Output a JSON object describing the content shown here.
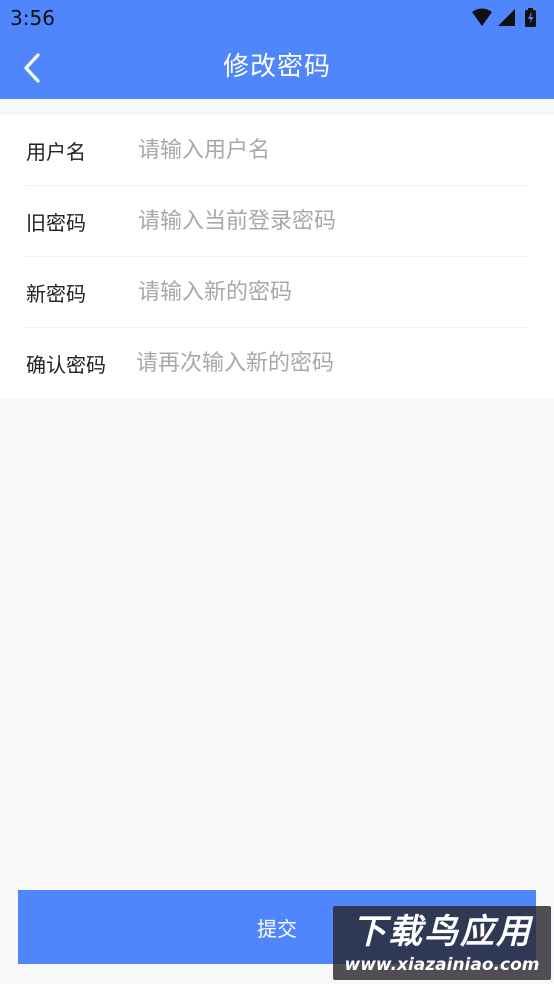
{
  "status_bar": {
    "time": "3:56",
    "icons": [
      "wifi-icon",
      "signal-icon",
      "battery-icon"
    ]
  },
  "app_bar": {
    "title": "修改密码",
    "back_icon": "chevron-left-icon"
  },
  "form": {
    "fields": [
      {
        "label": "用户名",
        "placeholder": "请输入用户名",
        "value": ""
      },
      {
        "label": "旧密码",
        "placeholder": "请输入当前登录密码",
        "value": ""
      },
      {
        "label": "新密码",
        "placeholder": "请输入新的密码",
        "value": ""
      },
      {
        "label": "确认密码",
        "placeholder": "请再次输入新的密码",
        "value": ""
      }
    ]
  },
  "submit": {
    "label": "提交"
  },
  "watermark": {
    "title": "下载鸟应用",
    "url": "www.xiazainiao.com"
  },
  "colors": {
    "primary": "#4f86fb",
    "background": "#f8f8f8",
    "placeholder": "#a8a8a8"
  }
}
